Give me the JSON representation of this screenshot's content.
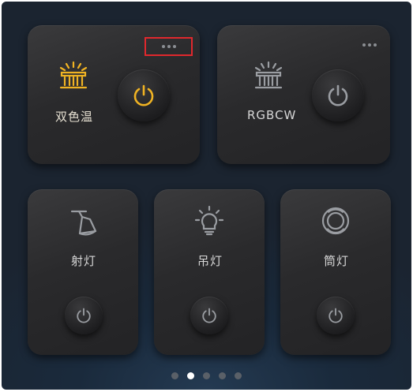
{
  "colors": {
    "accent": "#f0b323",
    "inactive_icon": "#9a9da2",
    "highlight_outline": "#e0282d"
  },
  "cards": {
    "dual_temp": {
      "label": "双色温",
      "icon": "strip-light-icon",
      "state": "on"
    },
    "rgbcw": {
      "label": "RGBCW",
      "icon": "strip-light-icon",
      "state": "off"
    },
    "spotlight": {
      "label": "射灯",
      "icon": "spotlight-icon",
      "state": "off"
    },
    "pendant": {
      "label": "吊灯",
      "icon": "bulb-icon",
      "state": "off"
    },
    "downlight": {
      "label": "筒灯",
      "icon": "downlight-icon",
      "state": "off"
    }
  },
  "pagination": {
    "pages": 5,
    "active": 2
  }
}
